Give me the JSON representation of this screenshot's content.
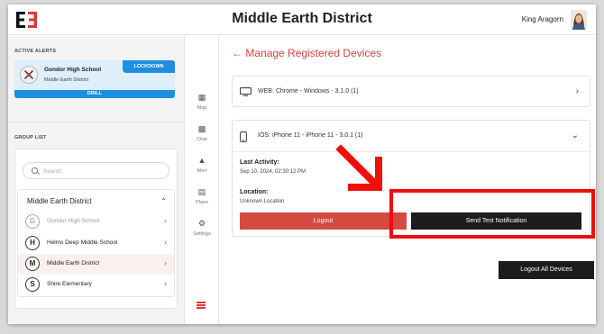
{
  "header": {
    "title": "Middle Earth District",
    "user_name": "King Aragorn"
  },
  "sidebar": {
    "active_alerts_label": "ACTIVE ALERTS",
    "alert": {
      "school": "Gondor High School",
      "district": "Middle Earth District",
      "badge": "LOCKDOWN",
      "mode": "DRILL"
    },
    "group_list_label": "GROUP LIST",
    "search_placeholder": "Search",
    "group": {
      "title": "Middle Earth District",
      "items": [
        {
          "initial": "G",
          "label": "Gondor High School"
        },
        {
          "initial": "H",
          "label": "Helms Deep Middle School"
        },
        {
          "initial": "M",
          "label": "Middle Earth District"
        },
        {
          "initial": "S",
          "label": "Shire Elementary"
        }
      ]
    }
  },
  "nav": {
    "items": [
      {
        "icon": "map-icon",
        "label": "Map"
      },
      {
        "icon": "chat-icon",
        "label": "Chat"
      },
      {
        "icon": "alert-icon",
        "label": "Alert"
      },
      {
        "icon": "plans-icon",
        "label": "Plans"
      },
      {
        "icon": "settings-icon",
        "label": "Settings"
      }
    ]
  },
  "main": {
    "page_title": "Manage Registered Devices",
    "devices": [
      {
        "icon": "monitor-icon",
        "name": "WEB: Chrome - Windows - 3.1.0 (1)"
      },
      {
        "icon": "phone-icon",
        "name": "IOS: iPhone 11 - iPhone 11 - 3.0.1 (1)"
      }
    ],
    "detail": {
      "last_activity_label": "Last Activity:",
      "last_activity_value": "Sep 10, 2024, 02:30:12 PM",
      "location_label": "Location:",
      "location_value": "Unknown Location",
      "logout_label": "Logout",
      "test_label": "Send Test Notification"
    },
    "logout_all_label": "Logout All Devices"
  },
  "colors": {
    "accent_red": "#d24640",
    "badge_blue": "#1e8fe0",
    "annotation_red": "#f20d0d"
  }
}
